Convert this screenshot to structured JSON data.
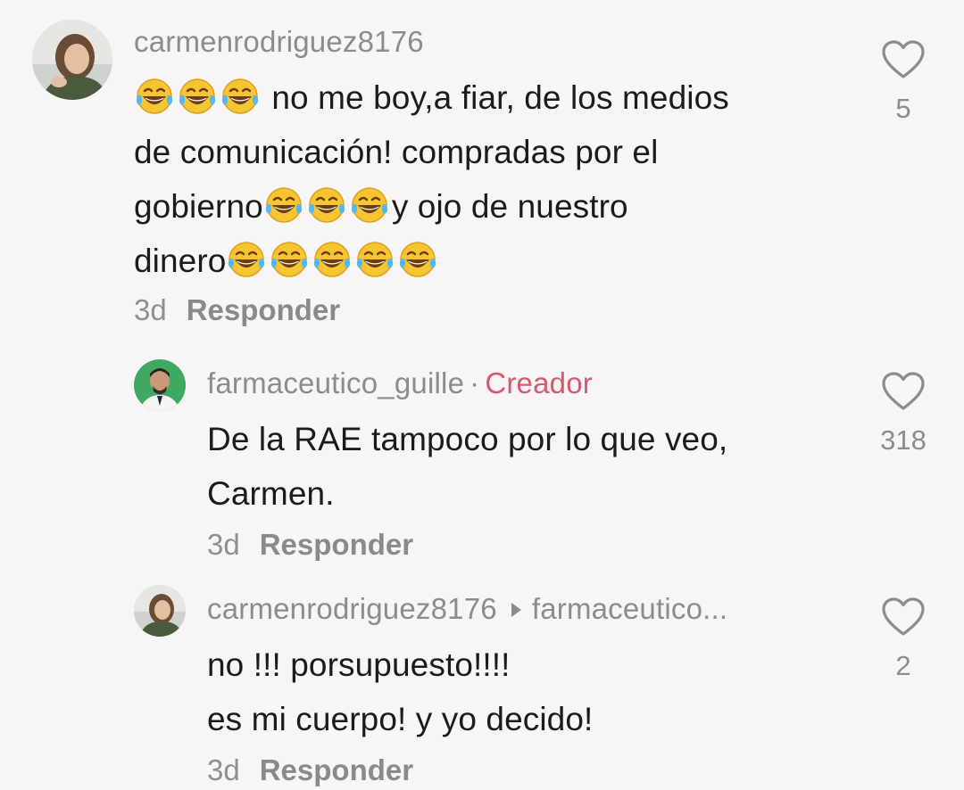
{
  "comments": [
    {
      "username": "carmenrodriguez8176",
      "lines": [
        {
          "emoji_before": 3,
          "text": " no me boy,a fiar, de los medios",
          "emoji_after": 0
        },
        {
          "emoji_before": 0,
          "text": "de comunicación! compradas por el",
          "emoji_after": 0
        },
        {
          "emoji_before": 0,
          "text": "gobierno",
          "emoji_after": 3,
          "tail": "y ojo de nuestro"
        },
        {
          "emoji_before": 0,
          "text": "dinero",
          "emoji_after": 5
        }
      ],
      "time": "3d",
      "reply_label": "Responder",
      "likes": "5"
    },
    {
      "username": "farmaceutico_guille",
      "separator": "·",
      "badge": "Creador",
      "lines": [
        "De la RAE tampoco por lo que veo,",
        "Carmen."
      ],
      "time": "3d",
      "reply_label": "Responder",
      "likes": "318"
    },
    {
      "username": "carmenrodriguez8176",
      "reply_to": "farmaceutico...",
      "lines": [
        "no !!! porsupuesto!!!!",
        "es mi cuerpo! y yo decido!"
      ],
      "time": "3d",
      "reply_label": "Responder",
      "likes": "2"
    }
  ],
  "icons": {
    "like": "heart-outline-icon",
    "emoji": "face-with-tears-of-joy-emoji",
    "reply_arrow": "triangle-right-icon"
  },
  "colors": {
    "creator_badge": "#d45a72",
    "secondary_text": "#8c8b8f",
    "primary_text": "#1b1b1f"
  }
}
